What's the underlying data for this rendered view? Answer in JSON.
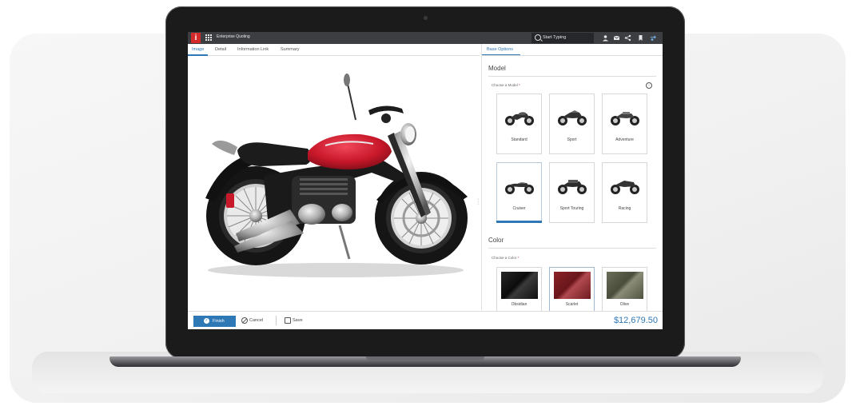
{
  "app": {
    "logo_letter": "i",
    "title": "Enterprise Quoting",
    "search_placeholder": "Start Typing",
    "topbar_icons": [
      "user-icon",
      "mail-icon",
      "share-icon",
      "bookmark-icon",
      "settings-icon"
    ]
  },
  "tabs": [
    {
      "label": "Image",
      "active": true
    },
    {
      "label": "Detail",
      "active": false
    },
    {
      "label": "Information Link",
      "active": false
    },
    {
      "label": "Summary",
      "active": false
    }
  ],
  "panel": {
    "tab_label": "Base Options",
    "model": {
      "section_title": "Model",
      "field_label": "Choose a Model",
      "required_marker": "*",
      "options": [
        {
          "label": "Standard",
          "selected": false
        },
        {
          "label": "Sport",
          "selected": false
        },
        {
          "label": "Adventure",
          "selected": false
        },
        {
          "label": "Cruiser",
          "selected": true
        },
        {
          "label": "Sport Touring",
          "selected": false
        },
        {
          "label": "Racing",
          "selected": false
        }
      ]
    },
    "color": {
      "section_title": "Color",
      "field_label": "Choose a Color",
      "required_marker": "*",
      "options": [
        {
          "label": "Obsidian",
          "hex": "#141414",
          "selected": false
        },
        {
          "label": "Scarlet",
          "hex": "#7d1d22",
          "selected": true
        },
        {
          "label": "Olive",
          "hex": "#5b5e4a",
          "selected": false
        }
      ]
    }
  },
  "footer": {
    "finish_label": "Finish",
    "cancel_label": "Cancel",
    "save_label": "Save",
    "price": "$12,679.50"
  },
  "colors": {
    "accent": "#2f78b6",
    "brand": "#d42a2a",
    "topbar": "#3d3e42",
    "bike_tank": "#c8182a"
  }
}
